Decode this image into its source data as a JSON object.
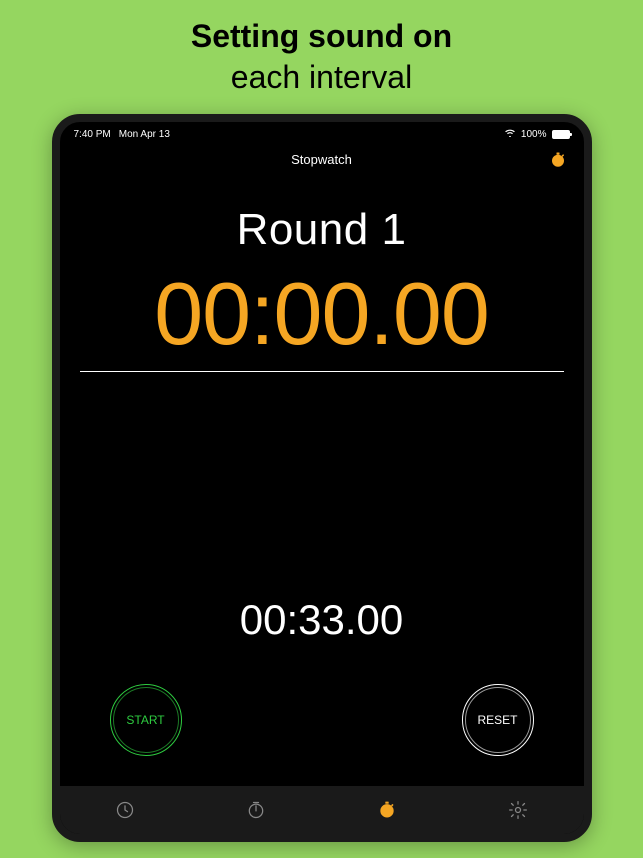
{
  "promo": {
    "line1": "Setting sound on",
    "line2": "each interval"
  },
  "status": {
    "time": "7:40 PM",
    "date": "Mon Apr 13",
    "battery_pct": "100%"
  },
  "header": {
    "title": "Stopwatch"
  },
  "main": {
    "round_label": "Round 1",
    "timer": "00:00.00",
    "sub_timer": "00:33.00"
  },
  "controls": {
    "start_label": "START",
    "reset_label": "RESET"
  },
  "colors": {
    "accent": "#f5a623",
    "start": "#2ecc40",
    "bg": "#95d660"
  }
}
